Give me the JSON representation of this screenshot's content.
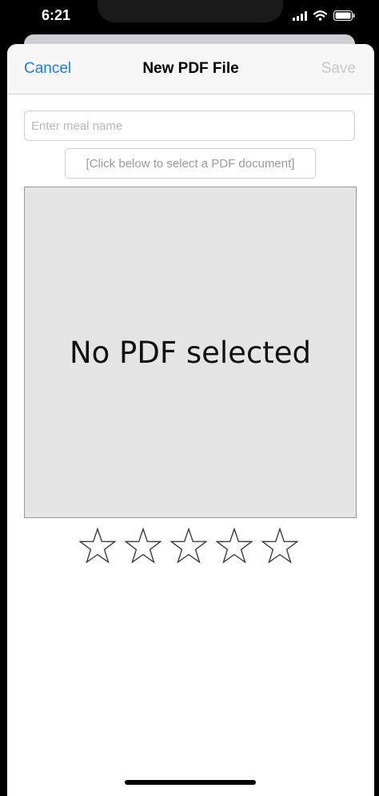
{
  "status_bar": {
    "time": "6:21"
  },
  "nav": {
    "cancel_label": "Cancel",
    "title": "New PDF File",
    "save_label": "Save"
  },
  "form": {
    "meal_name_placeholder": "Enter meal name",
    "meal_name_value": "",
    "select_pdf_label": "[Click below to select a PDF document]",
    "pdf_placeholder_text": "No PDF selected"
  },
  "rating": {
    "value": 0,
    "max": 5
  },
  "colors": {
    "accent": "#1d7cf2",
    "disabled": "#c7c7cc",
    "pdf_bg": "#e5e5e5"
  }
}
